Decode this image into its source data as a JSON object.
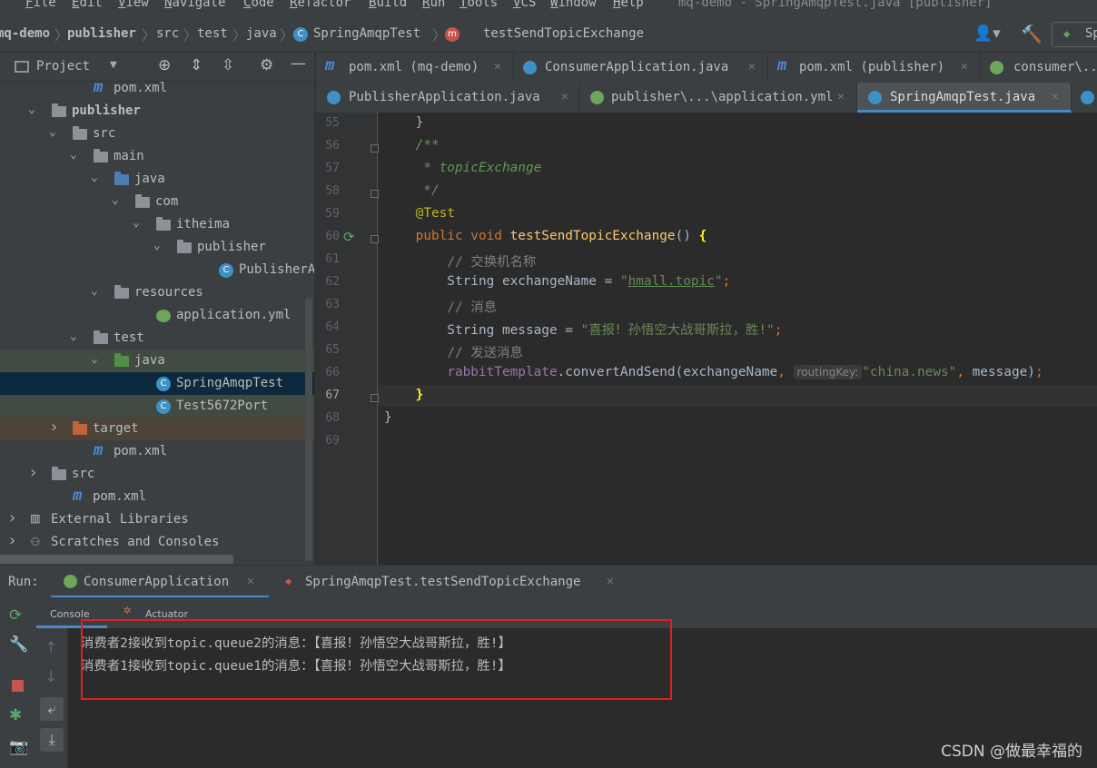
{
  "menu": {
    "items": [
      "File",
      "Edit",
      "View",
      "Navigate",
      "Code",
      "Refactor",
      "Build",
      "Run",
      "Tools",
      "VCS",
      "Window",
      "Help"
    ],
    "window_title": "mq-demo - SpringAmqpTest.java [publisher]"
  },
  "navbar": {
    "crumbs": [
      "mq-demo",
      "publisher",
      "src",
      "test",
      "java",
      "SpringAmqpTest",
      "testSendTopicExchange"
    ],
    "right_label": "Sp"
  },
  "project": {
    "title": "Project",
    "tree": [
      {
        "label": "pom.xml",
        "indent": 3,
        "icon": "maven",
        "arrow": ""
      },
      {
        "label": "publisher",
        "indent": 1,
        "icon": "folder",
        "arrow": "down",
        "bold": true
      },
      {
        "label": "src",
        "indent": 2,
        "icon": "folder",
        "arrow": "down"
      },
      {
        "label": "main",
        "indent": 3,
        "icon": "folder",
        "arrow": "down"
      },
      {
        "label": "java",
        "indent": 4,
        "icon": "folder-blue",
        "arrow": "down"
      },
      {
        "label": "com",
        "indent": 5,
        "icon": "package",
        "arrow": "down"
      },
      {
        "label": "itheima",
        "indent": 6,
        "icon": "package",
        "arrow": "down"
      },
      {
        "label": "publisher",
        "indent": 7,
        "icon": "package",
        "arrow": "down"
      },
      {
        "label": "PublisherApp",
        "indent": 9,
        "icon": "class",
        "arrow": ""
      },
      {
        "label": "resources",
        "indent": 4,
        "icon": "folder",
        "arrow": "down"
      },
      {
        "label": "application.yml",
        "indent": 6,
        "icon": "yml",
        "arrow": ""
      },
      {
        "label": "test",
        "indent": 3,
        "icon": "folder",
        "arrow": "down"
      },
      {
        "label": "java",
        "indent": 4,
        "icon": "folder-green",
        "arrow": "down",
        "bg": "#414b41"
      },
      {
        "label": "SpringAmqpTest",
        "indent": 6,
        "icon": "class",
        "arrow": "",
        "bg": "#0d293e"
      },
      {
        "label": "Test5672Port",
        "indent": 6,
        "icon": "class",
        "arrow": "",
        "bg": "#414b41"
      },
      {
        "label": "target",
        "indent": 2,
        "icon": "folder-orange",
        "arrow": "right",
        "bg": "#4c4339"
      },
      {
        "label": "pom.xml",
        "indent": 3,
        "icon": "maven",
        "arrow": ""
      },
      {
        "label": "src",
        "indent": 1,
        "icon": "folder",
        "arrow": "right"
      },
      {
        "label": "pom.xml",
        "indent": 2,
        "icon": "maven",
        "arrow": ""
      },
      {
        "label": "External Libraries",
        "indent": 0,
        "icon": "libs",
        "arrow": "right"
      },
      {
        "label": "Scratches and Consoles",
        "indent": 0,
        "icon": "scratch",
        "arrow": "right"
      }
    ]
  },
  "tabs": {
    "row1": [
      {
        "label": "pom.xml (mq-demo)",
        "icon": "maven"
      },
      {
        "label": "ConsumerApplication.java",
        "icon": "class"
      },
      {
        "label": "pom.xml (publisher)",
        "icon": "maven"
      },
      {
        "label": "consumer\\...",
        "icon": "yml"
      }
    ],
    "row2": [
      {
        "label": "PublisherApplication.java",
        "icon": "class"
      },
      {
        "label": "publisher\\...\\application.yml",
        "icon": "yml"
      },
      {
        "label": "SpringAmqpTest.java",
        "icon": "class",
        "active": true
      }
    ]
  },
  "editor": {
    "lines": [
      {
        "n": "55",
        "html": "    }"
      },
      {
        "n": "56",
        "html": "    <span class='doc'>/**</span>"
      },
      {
        "n": "57",
        "html": "<span class='doc'>     * topicExchange</span>"
      },
      {
        "n": "58",
        "html": "<span class='doc'>     */</span>"
      },
      {
        "n": "59",
        "html": "    <span class='ann'>@Test</span>"
      },
      {
        "n": "60",
        "html": "    <span class='kw'>public void </span><span class='fn'>testSendTopicExchange</span>() <span style='color:#ffef28;font-weight:bold'>{</span>"
      },
      {
        "n": "61",
        "html": "        <span class='cm'>// 交换机名称</span>"
      },
      {
        "n": "62",
        "html": "        String exchangeName = <span class='str'>\"<u style='text-decoration-color:#629755'>hmall.topic</u>\"</span><span class='kw'>;</span>"
      },
      {
        "n": "63",
        "html": "        <span class='cm'>// 消息</span>"
      },
      {
        "n": "64",
        "html": "        String message = <span class='str'>\"喜报！孙悟空大战哥斯拉，胜!\"</span><span class='kw'>;</span>"
      },
      {
        "n": "65",
        "html": "        <span class='cm'>// 发送消息</span>"
      },
      {
        "n": "66",
        "html": "        <span class='fld'>rabbitTemplate</span>.convertAndSend(exchangeName<span class='kw'>, </span><span class='hint'>routingKey:</span><span class='str'>\"china.news\"</span><span class='kw'>, </span>message)<span class='kw'>;</span>"
      },
      {
        "n": "67",
        "html": "    <span style='color:#ffef28;font-weight:bold'>}</span>"
      },
      {
        "n": "68",
        "html": "}"
      },
      {
        "n": "69",
        "html": ""
      }
    ]
  },
  "run": {
    "label": "Run:",
    "tabs": [
      "ConsumerApplication",
      "SpringAmqpTest.testSendTopicExchange"
    ],
    "subtabs": [
      "Console",
      "Actuator"
    ],
    "output": [
      "消费者2接收到topic.queue2的消息：【喜报！孙悟空大战哥斯拉，胜!】",
      "消费者1接收到topic.queue1的消息：【喜报！孙悟空大战哥斯拉，胜!】"
    ]
  },
  "watermark": "CSDN @做最幸福的"
}
